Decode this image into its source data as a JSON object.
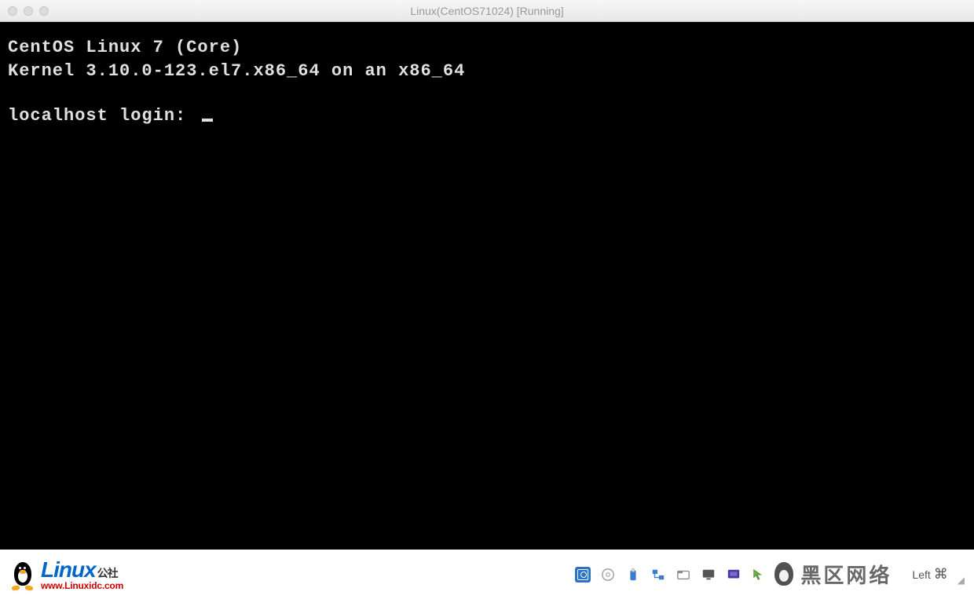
{
  "window": {
    "title": "Linux(CentOS71024) [Running]"
  },
  "terminal": {
    "line1": "CentOS Linux 7 (Core)",
    "line2": "Kernel 3.10.0-123.el7.x86_64 on an x86_64",
    "prompt": "localhost login: "
  },
  "watermark_left": {
    "title": "Linux",
    "suffix": "公社",
    "url": "www.Linuxidc.com"
  },
  "watermark_right": {
    "text": "黑区网络"
  },
  "statusbar": {
    "host_key": "Left",
    "host_key_symbol": "⌘"
  },
  "icons": {
    "hard_disk": "hard-disk-icon",
    "optical": "optical-drive-icon",
    "usb": "usb-icon",
    "network": "network-icon",
    "shared_folder": "shared-folder-icon",
    "display": "display-icon",
    "capture": "capture-icon",
    "mouse_integration": "mouse-integration-icon"
  }
}
